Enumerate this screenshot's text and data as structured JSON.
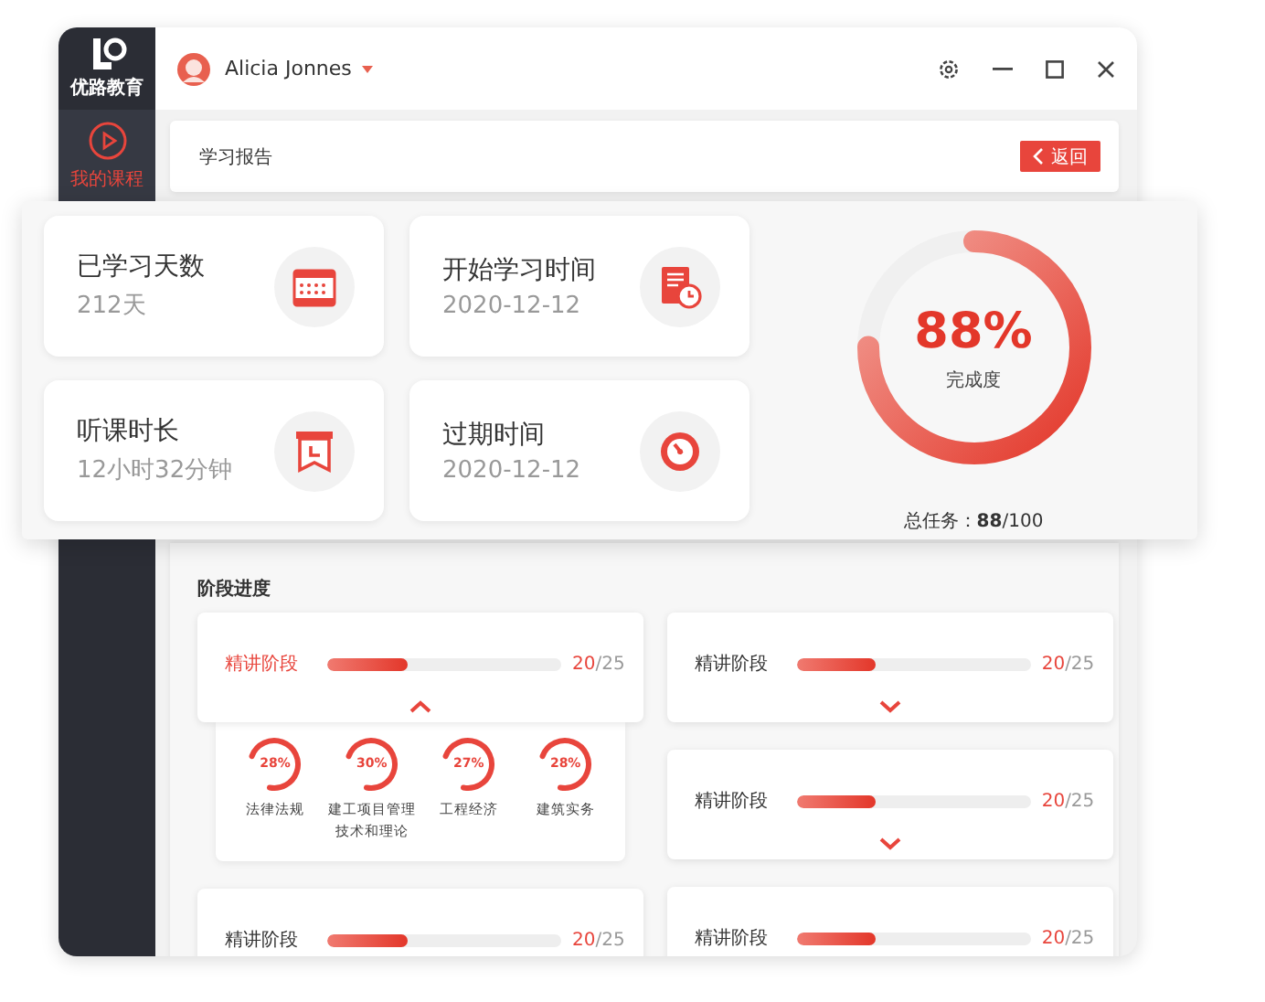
{
  "sidebar": {
    "logo_text": "优路教育",
    "items": [
      {
        "label": "我的课程",
        "selected": true
      }
    ]
  },
  "user": {
    "name": "Alicia Jonnes"
  },
  "header": {
    "title": "学习报告",
    "back_button": "返回"
  },
  "stats": [
    {
      "kind": "calendar",
      "title": "已学习天数",
      "value": "212天"
    },
    {
      "kind": "notebook",
      "title": "开始学习时间",
      "value": "2020-12-12"
    },
    {
      "kind": "board",
      "title": "听课时长",
      "value": "12小时32分钟"
    },
    {
      "kind": "gauge",
      "title": "过期时间",
      "value": "2020-12-12"
    }
  ],
  "completion": {
    "percent": "88%",
    "label": "完成度",
    "level": 0.75,
    "total": "总任务：**88**/100"
  },
  "stages": {
    "title": "阶段进度",
    "columns": [
      {
        "items": [
          {
            "name": "精讲阶段",
            "level": 0.34,
            "done": "20",
            "total": "/25",
            "expanded": true,
            "subjects": [
              {
                "percent": "28%",
                "name": "法律法规"
              },
              {
                "percent": "30%",
                "name": "建工项目管理技术和理论"
              },
              {
                "percent": "27%",
                "name": "工程经济"
              },
              {
                "percent": "28%",
                "name": "建筑实务"
              }
            ]
          },
          {
            "name": "精讲阶段",
            "level": 0.34,
            "done": "20",
            "total": "/25"
          }
        ]
      },
      {
        "items": [
          {
            "name": "精讲阶段",
            "level": 0.34,
            "done": "20",
            "total": "/25",
            "expanded": false
          },
          {
            "name": "精讲阶段",
            "level": 0.34,
            "done": "20",
            "total": "/25",
            "expanded": false
          },
          {
            "name": "精讲阶段",
            "level": 0.34,
            "done": "20",
            "total": "/25"
          }
        ]
      }
    ]
  }
}
